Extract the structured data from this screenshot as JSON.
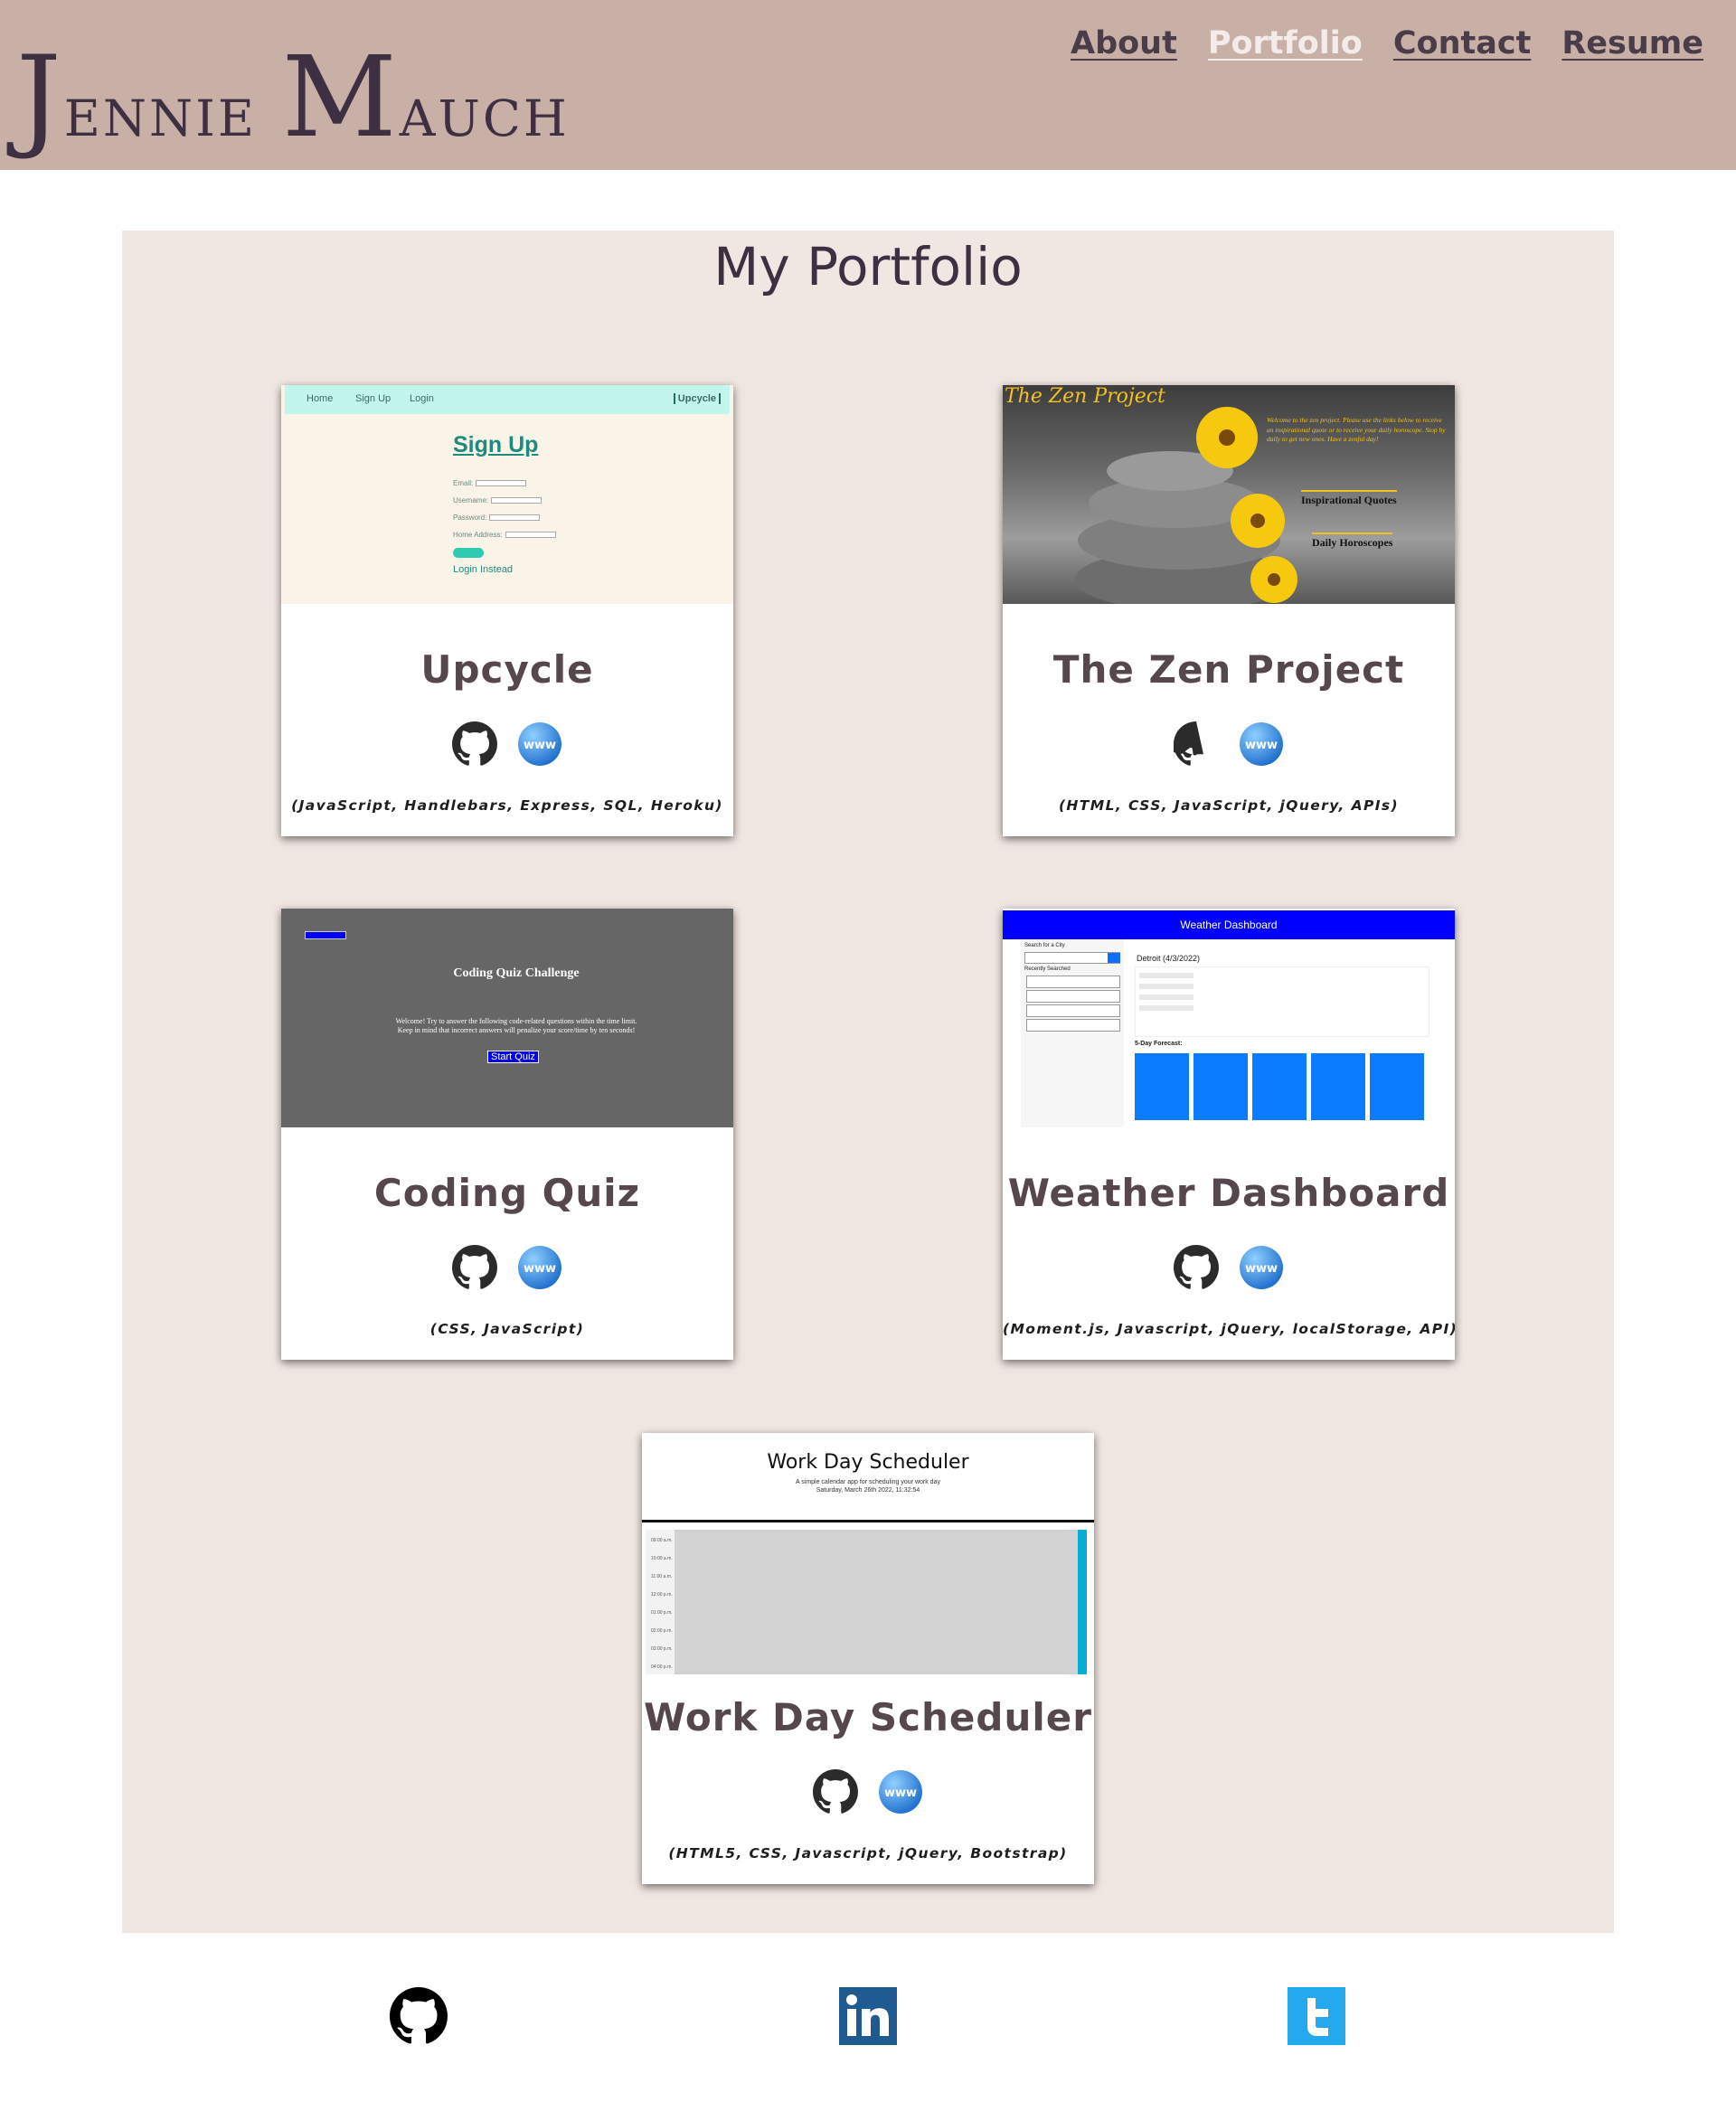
{
  "header": {
    "logo_first_initial": "J",
    "logo_first_rest": "ennie",
    "logo_last_initial": "M",
    "logo_last_rest": "auch",
    "nav": [
      "About",
      "Portfolio",
      "Contact",
      "Resume"
    ],
    "active_nav": "Portfolio"
  },
  "main": {
    "title": "My Portfolio",
    "projects": [
      {
        "title": "Upcycle",
        "tech": "(JavaScript, Handlebars, Express, SQL, Heroku)",
        "thumb": {
          "nav": [
            "Home",
            "Sign Up",
            "Login"
          ],
          "brand": "Upcycle",
          "heading": "Sign Up",
          "fields": [
            "Email:",
            "Username:",
            "Password:",
            "Home Address:"
          ],
          "link": "Login Instead"
        }
      },
      {
        "title": "The Zen Project",
        "tech": "(HTML, CSS, JavaScript, jQuery, APIs)",
        "thumb": {
          "heading": "The Zen Project",
          "blurb": "Welcome to the zen project. Please use the links below to receive an inspirational quote or to receive your daily horoscope. Stop by daily to get new ones. Have a zenful day!",
          "links": [
            "Inspirational Quotes",
            "Daily Horoscopes"
          ]
        }
      },
      {
        "title": "Coding Quiz",
        "tech": "(CSS, JavaScript)",
        "thumb": {
          "heading": "Coding Quiz Challenge",
          "text_line1": "Welcome! Try to answer the following code-related questions within the time limit.",
          "text_line2": "Keep in mind that incorrect answers will penalize your score/time by ten seconds!",
          "button": "Start Quiz"
        }
      },
      {
        "title": "Weather Dashboard",
        "tech": "(Moment.js, Javascript, jQuery, localStorage, API)",
        "thumb": {
          "heading": "Weather Dashboard",
          "search_label": "Search for a City",
          "recent_label": "Recently Searched",
          "city": "Detroit (4/3/2022)",
          "forecast_label": "5-Day Forecast:"
        }
      },
      {
        "title": "Work Day Scheduler",
        "tech": "(HTML5, CSS, Javascript, jQuery, Bootstrap)",
        "thumb": {
          "heading": "Work Day Scheduler",
          "subtitle": "A simple calendar app for scheduling your work day",
          "date": "Saturday, March 26th 2022, 11:32:54",
          "times": [
            "09:00 a.m.",
            "10:00 a.m.",
            "11:00 a.m.",
            "12:00 p.m.",
            "01:00 p.m.",
            "02:00 p.m.",
            "03:00 p.m.",
            "04:00 p.m."
          ]
        }
      }
    ]
  },
  "footer": {
    "icons": [
      "github-icon",
      "linkedin-icon",
      "twitter-icon"
    ]
  },
  "colors": {
    "header_bg": "#c9b0a6",
    "panel_bg": "#f0e6e2",
    "logo": "#3f2f42",
    "nav_active": "#f4ecea"
  }
}
